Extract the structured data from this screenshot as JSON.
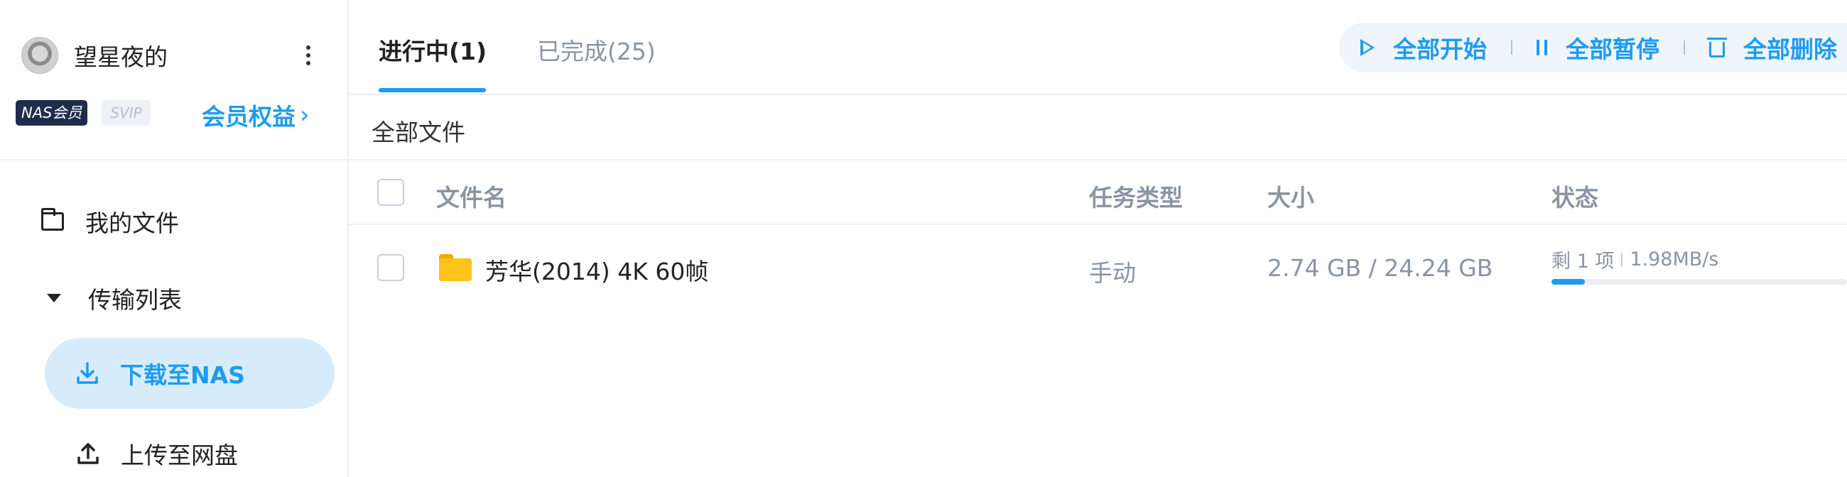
{
  "sidebar": {
    "username": "望星夜的",
    "badge_nas": "NAS会员",
    "badge_svip": "SVIP",
    "member_link": "会员权益",
    "nav": {
      "my_files": "我的文件",
      "transfer_list": "传输列表",
      "download_to_nas": "下载至NAS",
      "upload_to_netdisk": "上传至网盘"
    }
  },
  "tabs": {
    "in_progress": "进行中(1)",
    "completed": "已完成(25)"
  },
  "toolbar": {
    "start_all": "全部开始",
    "pause_all": "全部暂停",
    "delete_all": "全部删除"
  },
  "breadcrumb": "全部文件",
  "table": {
    "headers": {
      "name": "文件名",
      "task_type": "任务类型",
      "size": "大小",
      "status": "状态"
    },
    "rows": [
      {
        "name": "芳华(2014) 4K 60帧",
        "task_type": "手动",
        "size": "2.74 GB / 24.24 GB",
        "remaining": "剩 1 项",
        "speed": "1.98MB/s",
        "progress": 0.113
      }
    ]
  },
  "colors": {
    "accent": "#1e9bf0",
    "active_nav_bg": "#d7ecfb",
    "folder": "#ffc31a"
  }
}
